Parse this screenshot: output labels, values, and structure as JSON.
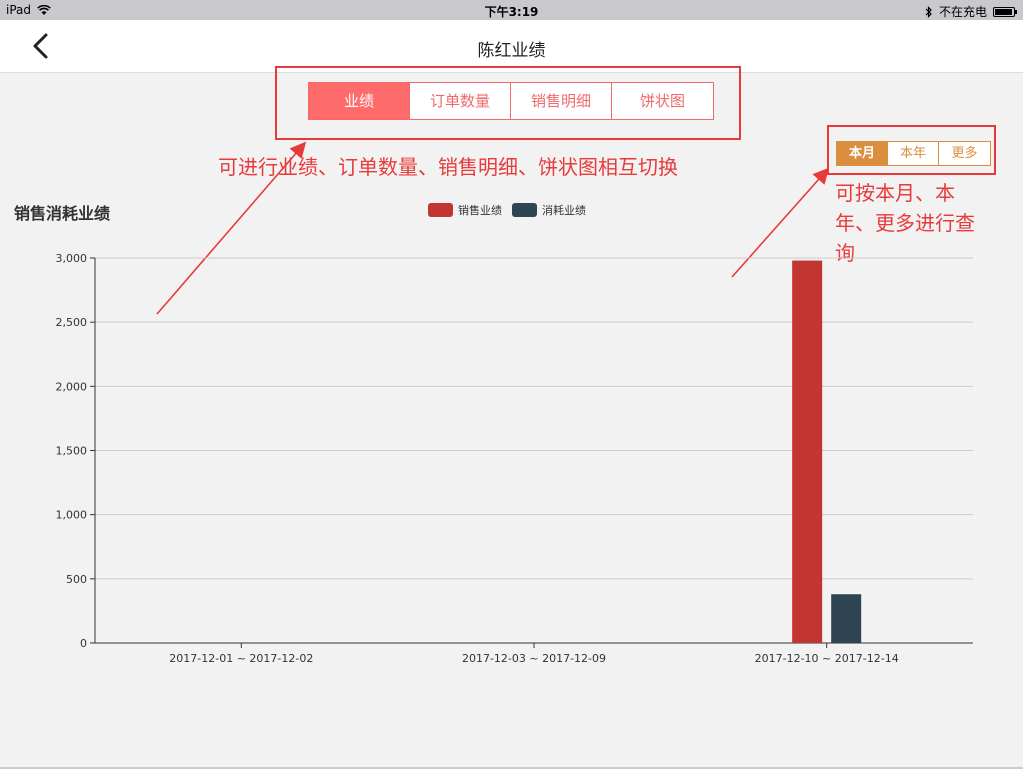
{
  "status": {
    "device": "iPad",
    "time": "下午3:19",
    "charging": "不在充电"
  },
  "nav": {
    "title": "陈红业绩"
  },
  "tabs": [
    {
      "label": "业绩",
      "active": true
    },
    {
      "label": "订单数量",
      "active": false
    },
    {
      "label": "销售明细",
      "active": false
    },
    {
      "label": "饼状图",
      "active": false
    }
  ],
  "period_tabs": [
    {
      "label": "本月",
      "active": true
    },
    {
      "label": "本年",
      "active": false
    },
    {
      "label": "更多",
      "active": false
    }
  ],
  "annotations": {
    "tabs_note": "可进行业绩、订单数量、销售明细、饼状图相互切换",
    "period_note_line1": "可按本月、本",
    "period_note_line2": "年、更多进行查",
    "period_note_line3": "询"
  },
  "colors": {
    "accent": "#ff6b6b",
    "period": "#d98f3e",
    "annotation": "#e83a3a"
  },
  "chart_data": {
    "type": "bar",
    "title": "销售消耗业绩",
    "categories": [
      "2017-12-01 ~ 2017-12-02",
      "2017-12-03 ~ 2017-12-09",
      "2017-12-10 ~ 2017-12-14"
    ],
    "series": [
      {
        "name": "销售业绩",
        "color": "#c23531",
        "values": [
          0,
          0,
          2980
        ]
      },
      {
        "name": "消耗业绩",
        "color": "#2f4554",
        "values": [
          0,
          0,
          380
        ]
      }
    ],
    "yticks": [
      "0",
      "500",
      "1,000",
      "1,500",
      "2,000",
      "2,500",
      "3,000"
    ],
    "ylim": [
      0,
      3000
    ],
    "grid": true,
    "legend": "top"
  }
}
